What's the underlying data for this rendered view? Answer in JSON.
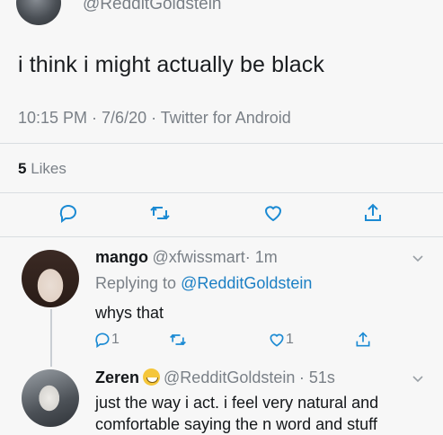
{
  "main_tweet": {
    "handle": "@RedditGoldstein",
    "text": "i think i might actually be black",
    "meta": "10:15 PM · 7/6/20 · Twitter for Android",
    "likes_count": "5",
    "likes_label": "Likes"
  },
  "replies": [
    {
      "name": "mango",
      "handle": "@xfwissmart",
      "time": "· 1m",
      "replying_prefix": "Replying to ",
      "replying_to": "@RedditGoldstein",
      "text": "whys that",
      "reply_count": "1",
      "like_count": "1"
    },
    {
      "name": "Zeren",
      "handle": "@RedditGoldstein",
      "time": "· 51s",
      "text_line1": "just the way i act. i feel very natural and",
      "text_line2": "comfortable saying the n word and stuff"
    }
  ],
  "icons": [
    "reply-icon",
    "retweet-icon",
    "like-icon",
    "share-icon",
    "chevron-down-icon",
    "grinning-emoji-icon"
  ],
  "colors": {
    "link": "#1b7fc4",
    "secondary": "#7a8087",
    "icon": "#1b8ad3",
    "thread": "#c9ced3"
  }
}
